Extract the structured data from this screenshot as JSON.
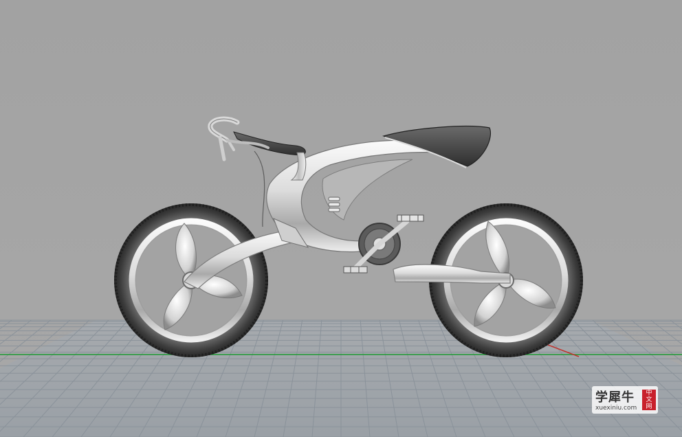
{
  "viewport": {
    "background": "#a4a4a4",
    "grid_color": "#8a929a",
    "axis_x_color": "#1f9a35",
    "axis_y_color": "#c0322b"
  },
  "model": {
    "name": "bicycle",
    "material_light": "#e9e9e9",
    "material_dark": "#3a3a3a"
  },
  "watermark": {
    "title": "学犀牛",
    "badge_chars": [
      "中",
      "文",
      "网"
    ],
    "url": "xuexiniu.com",
    "badge_color": "#c8202b"
  }
}
